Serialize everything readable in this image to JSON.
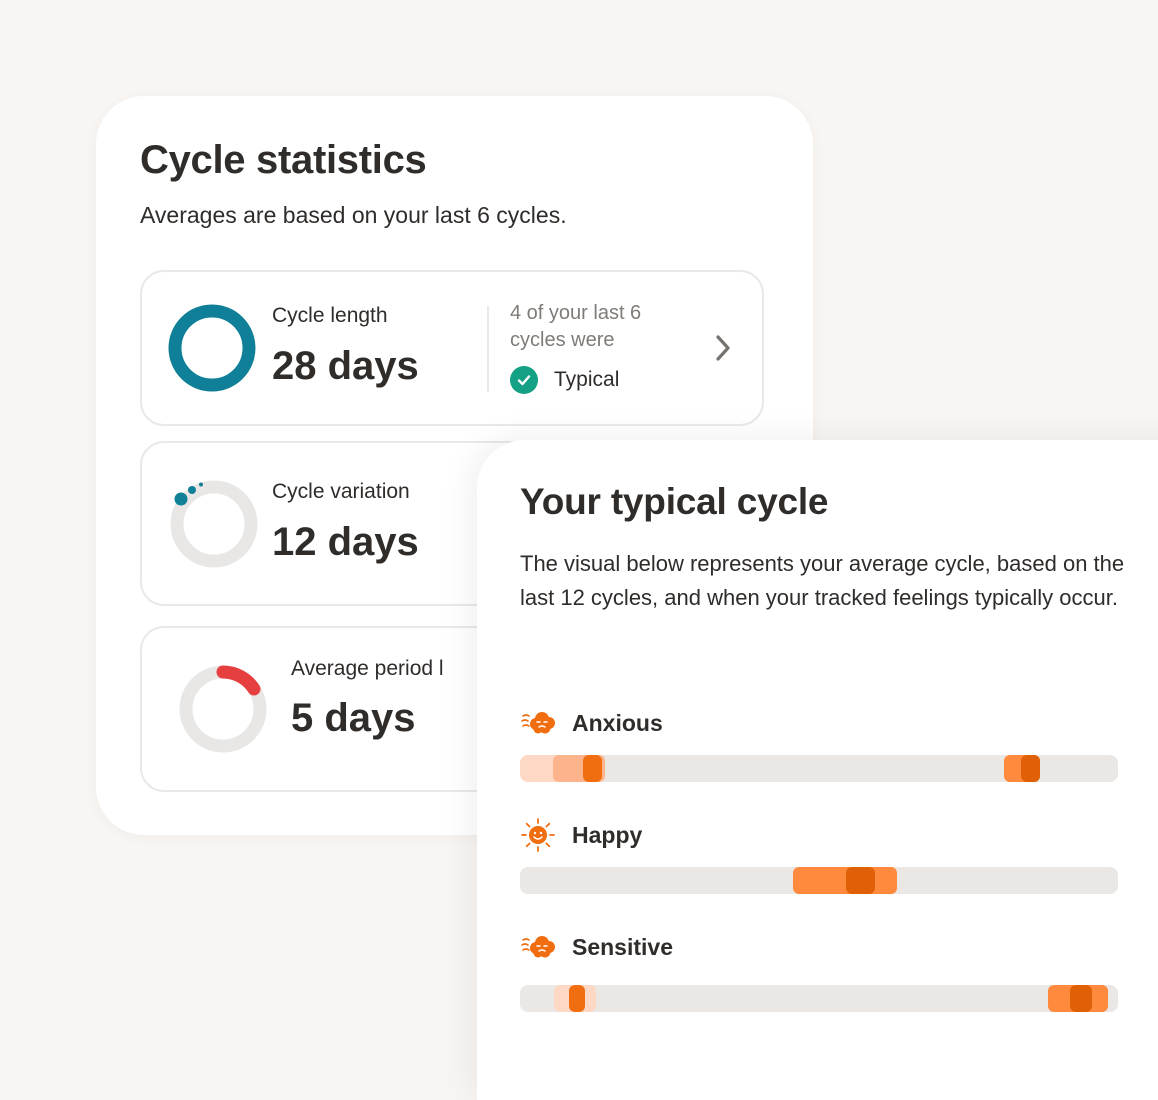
{
  "stats": {
    "title": "Cycle statistics",
    "subtitle": "Averages are based on your last 6 cycles.",
    "cycle_length": {
      "label": "Cycle length",
      "value": "28 days",
      "note": "4 of your last 6 cycles were",
      "status": "Typical"
    },
    "cycle_variation": {
      "label": "Cycle variation",
      "value": "12 days"
    },
    "period_length": {
      "label": "Average period l",
      "value": "5 days"
    }
  },
  "typical": {
    "title": "Your typical cycle",
    "description": "The visual below represents your average cycle, based on the last 12 cycles, and when your tracked feelings typically occur.",
    "feelings": [
      {
        "label": "Anxious",
        "icon": "cloud-icon"
      },
      {
        "label": "Happy",
        "icon": "sun-icon"
      },
      {
        "label": "Sensitive",
        "icon": "cloud-icon"
      }
    ]
  },
  "colors": {
    "background": "#f8f5f2",
    "teal": "#0f8098",
    "green_check": "#14a085",
    "red": "#e63f3f",
    "orange_light": "#fdd8c4",
    "orange_mid": "#fdb48c",
    "orange": "#ff8a3d",
    "orange_strong": "#f06d10",
    "orange_dark": "#e06008",
    "track": "#eae7e4"
  }
}
